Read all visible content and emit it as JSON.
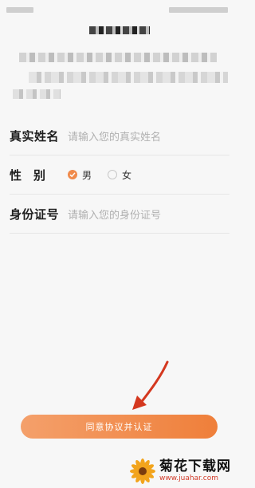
{
  "form": {
    "name_label": "真实姓名",
    "name_placeholder": "请输入您的真实姓名",
    "gender_label": "性别",
    "gender_options": [
      "男",
      "女"
    ],
    "id_label": "身份证号",
    "id_placeholder": "请输入您的身份证号"
  },
  "submit_label": "同意协议并认证",
  "watermark": {
    "cn": "菊花下载网",
    "url": "www.juahar.com"
  },
  "colors": {
    "accent": "#ef7f3a",
    "arrow": "#d4381f"
  }
}
